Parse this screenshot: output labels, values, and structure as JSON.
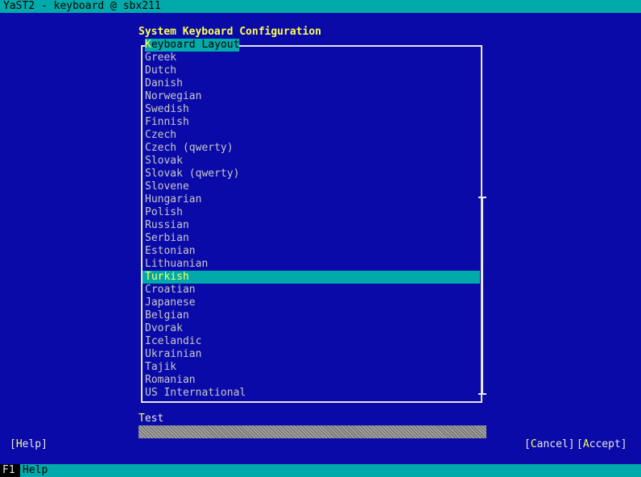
{
  "window": {
    "title": "YaST2 - keyboard @ sbx211"
  },
  "dialog": {
    "title": "System Keyboard Configuration"
  },
  "layout_list": {
    "label_hotkey": "K",
    "label_rest": "eyboard Layout",
    "selected": "Turkish",
    "items": [
      "Greek",
      "Dutch",
      "Danish",
      "Norwegian",
      "Swedish",
      "Finnish",
      "Czech",
      "Czech (qwerty)",
      "Slovak",
      "Slovak (qwerty)",
      "Slovene",
      "Hungarian",
      "Polish",
      "Russian",
      "Serbian",
      "Estonian",
      "Lithuanian",
      "Turkish",
      "Croatian",
      "Japanese",
      "Belgian",
      "Dvorak",
      "Icelandic",
      "Ukrainian",
      "Tajik",
      "Romanian",
      "US International"
    ]
  },
  "test": {
    "label_hotkey": "T",
    "label_rest": "est",
    "value": ""
  },
  "buttons": {
    "help_open": "[",
    "help_hotkey": "H",
    "help_rest": "elp]",
    "cancel_open": "[",
    "cancel_hotkey": "C",
    "cancel_rest": "ancel]",
    "accept_open": "[",
    "accept_hotkey": "A",
    "accept_rest": "ccept]"
  },
  "status_bar": {
    "key": "F1",
    "label": "Help"
  },
  "colors": {
    "background": "#0a0aa8",
    "accent": "#00aaaa",
    "highlight_text": "#ffff55",
    "text": "#c8c8c8"
  }
}
